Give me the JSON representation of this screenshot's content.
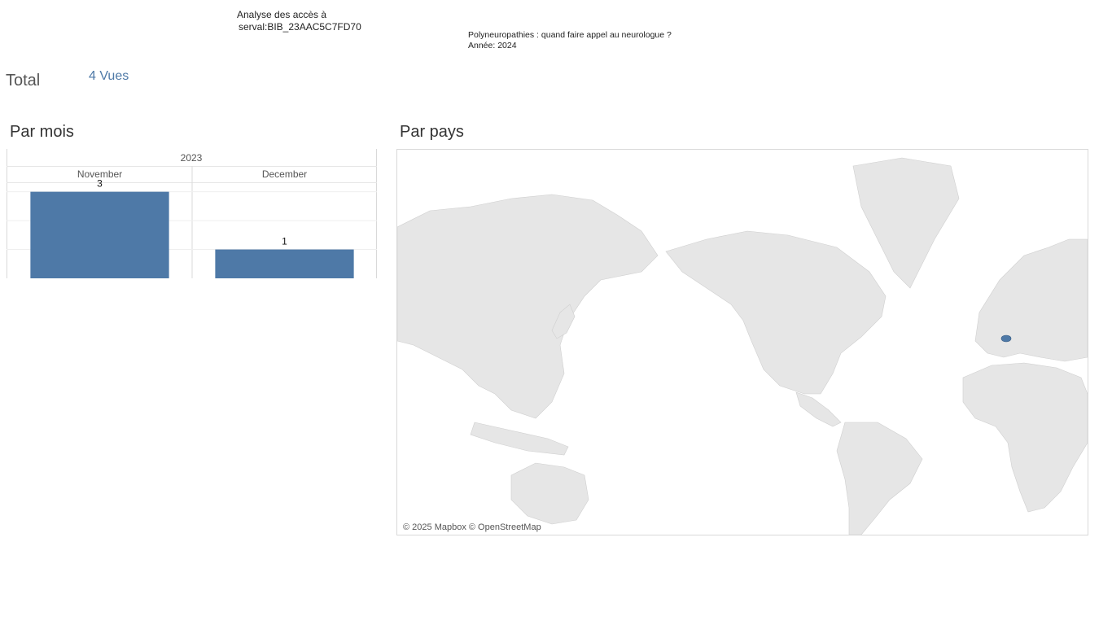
{
  "header": {
    "title_line1": "Analyse des accès à",
    "title_line2": "serval:BIB_23AAC5C7FD70",
    "doc_title": "Polyneuropathies : quand faire appel au neurologue ?",
    "doc_year": "Année: 2024"
  },
  "total": {
    "label": "Total",
    "value": "4 Vues"
  },
  "sections": {
    "by_month": "Par mois",
    "by_country": "Par pays"
  },
  "chart_data": {
    "type": "bar",
    "year_header": "2023",
    "categories": [
      "November",
      "December"
    ],
    "values": [
      3,
      1
    ],
    "ylim": [
      0,
      3.3
    ],
    "bar_color": "#4e79a7",
    "grid": true
  },
  "map": {
    "credit": "© 2025 Mapbox © OpenStreetMap",
    "highlight_color": "#4e79a7",
    "land_color": "#e6e6e6"
  }
}
